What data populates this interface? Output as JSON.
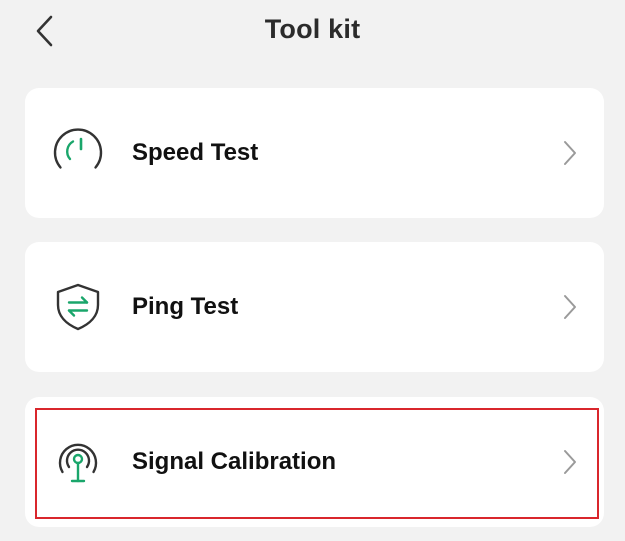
{
  "header": {
    "title": "Tool kit",
    "back_icon": "chevron-left-icon"
  },
  "tools": [
    {
      "label": "Speed Test",
      "icon": "speedometer-icon",
      "chevron": "chevron-right-icon"
    },
    {
      "label": "Ping Test",
      "icon": "shield-arrows-icon",
      "chevron": "chevron-right-icon"
    },
    {
      "label": "Signal Calibration",
      "icon": "signal-antenna-icon",
      "chevron": "chevron-right-icon",
      "highlighted": true
    }
  ],
  "colors": {
    "background": "#f2f2f2",
    "card": "#ffffff",
    "accent": "#1aa66b",
    "icon_stroke": "#333333",
    "chevron": "#9a9a9a",
    "highlight": "#d9262c"
  }
}
